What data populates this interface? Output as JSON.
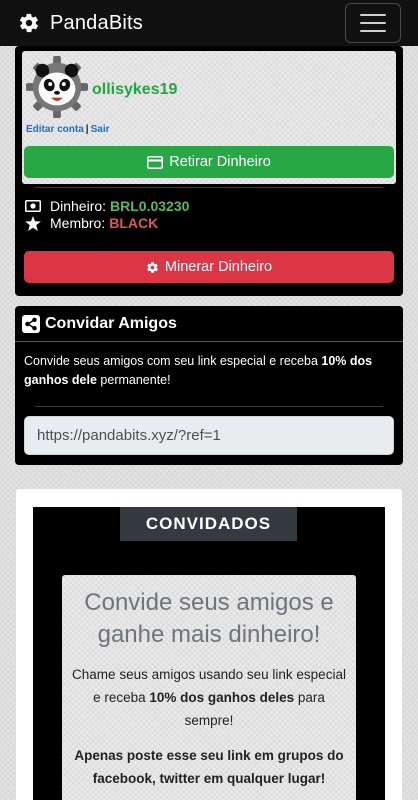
{
  "navbar": {
    "brand": "PandaBits",
    "brand_icon": "gear-icon",
    "menu_icon": "hamburger-menu-icon"
  },
  "profile": {
    "username": "ollisykes19",
    "edit_link": "Editar conta",
    "separator": "|",
    "logout_link": "Sair",
    "withdraw_button": "Retirar Dinheiro",
    "money_label": "Dinheiro:",
    "money_value": "BRL0.03230",
    "member_label": "Membro:",
    "member_value": "BLACK",
    "mine_button": "Minerar Dinheiro"
  },
  "invite": {
    "title": "Convidar Amigos",
    "text_before": "Convide seus amigos com seu link especial e receba ",
    "text_bold": "10% dos ganhos dele",
    "text_after": " permanente!",
    "ref_link": "https://pandabits.xyz/?ref=1"
  },
  "invited": {
    "tag": "CONVIDADOS",
    "heading": "Convide seus amigos e ganhe mais dinheiro!",
    "text_before": "Chame seus amigos usando seu link especial e receba ",
    "text_bold": "10% dos ganhos deles",
    "text_after": " para sempre!",
    "strong_text": "Apenas poste esse seu link em grupos do facebook, twitter em qualquer lugar!"
  },
  "colors": {
    "success": "#28a745",
    "danger": "#dc3545",
    "link": "#1a6fd1",
    "navbar": "#111111"
  }
}
